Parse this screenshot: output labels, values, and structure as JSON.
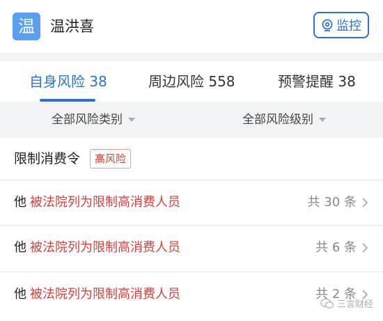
{
  "header": {
    "avatar_char": "温",
    "company_name": "温洪喜",
    "monitor_label": "监控"
  },
  "tabs": [
    {
      "label": "自身风险 38",
      "active": true
    },
    {
      "label": "周边风险 558",
      "active": false
    },
    {
      "label": "预警提醒 38",
      "active": false
    }
  ],
  "filters": {
    "category": "全部风险类别",
    "level": "全部风险级别"
  },
  "section": {
    "title": "限制消费令",
    "badge": "高风险"
  },
  "rows": [
    {
      "prefix": "他",
      "desc": "被法院列为限制高消费人员",
      "count": "共 30 条"
    },
    {
      "prefix": "他",
      "desc": "被法院列为限制高消费人员",
      "count": "共 6 条"
    },
    {
      "prefix": "他",
      "desc": "被法院列为限制高消费人员",
      "count": "共 2 条"
    }
  ],
  "watermark": "三言财经",
  "colors": {
    "accent": "#2a72d6",
    "danger": "#d4403a",
    "avatar_bg": "#5aa0ee"
  }
}
